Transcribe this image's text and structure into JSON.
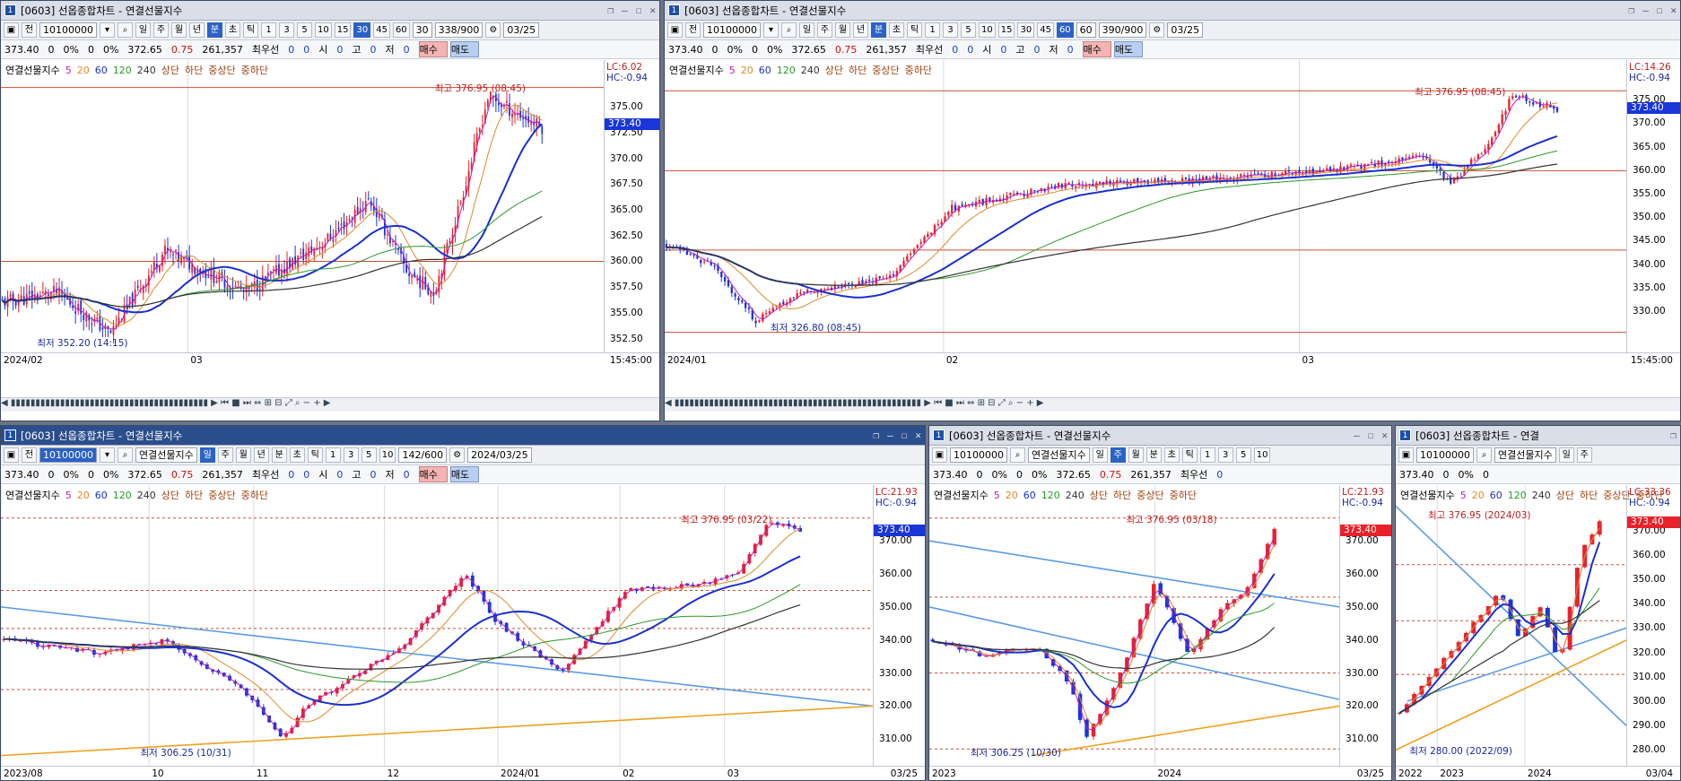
{
  "common": {
    "code": "10100000",
    "name": "연결선물지수",
    "title_text": "[0603] 선옵종합차트 - 연결선물지수",
    "btn_prev": "전",
    "period": [
      "일",
      "주",
      "월",
      "년",
      "분",
      "초",
      "틱"
    ],
    "intervals_min": [
      "1",
      "3",
      "5",
      "10",
      "15",
      "30",
      "45",
      "60"
    ],
    "quote": {
      "price": "373.40",
      "chg": "0",
      "chgpct": "0%",
      "vol": "0",
      "volpct": "0%",
      "v1": "372.65",
      "v2": "0.75",
      "v3": "261,357",
      "label_best": "최우선",
      "b1": "0",
      "b2": "0",
      "open_label": "시",
      "open": "0",
      "high_label": "고",
      "high": "0",
      "low_label": "저",
      "low": "0"
    },
    "buy": "매수",
    "sell": "매도",
    "ma": [
      "5",
      "20",
      "60",
      "120",
      "240"
    ],
    "extra_legend": [
      "상단",
      "하단",
      "중상단",
      "중하단"
    ],
    "hc": "HC:-0.94",
    "cur": "373.40",
    "date_input": "03/25",
    "chk0": "0"
  },
  "w1": {
    "title_num": "1",
    "combo": "30",
    "count": "338/900",
    "lc": "LC:6.02",
    "yticks": [
      "375.00",
      "372.50",
      "370.00",
      "367.50",
      "365.00",
      "362.50",
      "360.00",
      "357.50",
      "355.00",
      "352.50"
    ],
    "xlabels": [
      "2024/02",
      "03"
    ],
    "time": "15:45:00",
    "hi": "최고 376.95 (08:45)",
    "lo": "최저 352.20 (14:15)"
  },
  "w2": {
    "title_num": "1",
    "combo": "60",
    "count": "390/900",
    "lc": "LC:14.26",
    "yticks": [
      "375.00",
      "370.00",
      "365.00",
      "360.00",
      "355.00",
      "350.00",
      "345.00",
      "340.00",
      "335.00",
      "330.00"
    ],
    "xlabels": [
      "2024/01",
      "02",
      "03"
    ],
    "time": "15:45:00",
    "hi": "최고 376.95 (08:45)",
    "lo": "최저 326.80 (08:45)"
  },
  "w3": {
    "title_num": "1",
    "count": "142/600",
    "date": "2024/03/25",
    "lc": "LC:21.93",
    "yticks": [
      "370.00",
      "360.00",
      "350.00",
      "340.00",
      "330.00",
      "320.00",
      "310.00"
    ],
    "xlabels": [
      "2023/08",
      "10",
      "11",
      "12",
      "2024/01",
      "02",
      "03"
    ],
    "end": "03/25",
    "hi": "최고 376.95 (03/22)",
    "lo": "최저 306.25 (10/31)"
  },
  "w4": {
    "title_num": "1",
    "lc": "LC:21.93",
    "yticks": [
      "370.00",
      "360.00",
      "350.00",
      "340.00",
      "330.00",
      "320.00",
      "310.00"
    ],
    "xlabels": [
      "2023",
      "2024"
    ],
    "end": "03/25",
    "hi": "최고 376.95 (03/18)",
    "lo": "최저 306.25 (10/30)"
  },
  "w5": {
    "title_num": "1",
    "title_text": "[0603] 선옵종합차트 - 연결",
    "lc": "LC:33.36",
    "yticks": [
      "370.00",
      "360.00",
      "350.00",
      "340.00",
      "330.00",
      "320.00",
      "310.00",
      "300.00",
      "290.00",
      "280.00"
    ],
    "xlabels": [
      "2022",
      "2023",
      "2024"
    ],
    "end": "03/04",
    "hi": "최고 376.95 (2024/03)",
    "lo": "최저 280.00 (2022/09)"
  },
  "colors": {
    "up": "#e8222b",
    "down": "#1a35d8",
    "ma5": "#c01ac0",
    "ma20": "#e08a2a",
    "ma60": "#1a30d0",
    "ma120": "#2a9a2a",
    "ma240": "#333333",
    "hline": "#c85030",
    "trend": "#5a9ae8",
    "trend2": "#f0a020"
  }
}
